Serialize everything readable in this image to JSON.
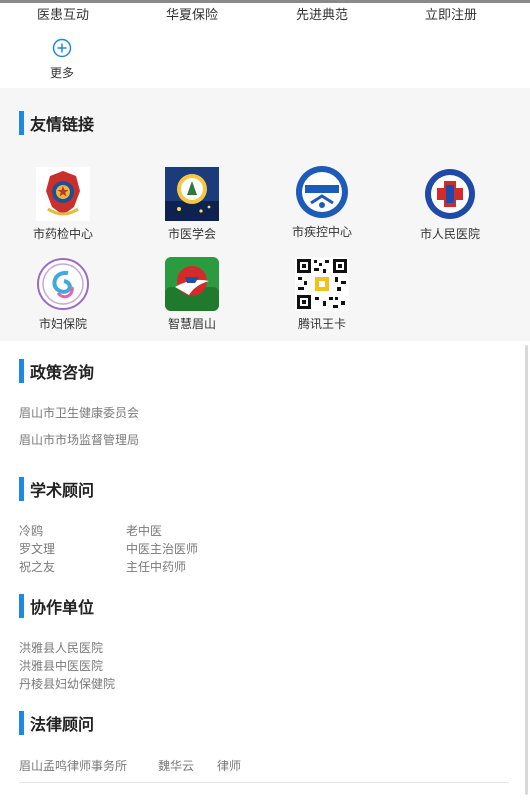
{
  "top_links": [
    "医患互动",
    "华夏保险",
    "先进典范",
    "立即注册"
  ],
  "more_label": "更多",
  "friend_links": {
    "title": "友情链接",
    "items": [
      {
        "label": "市药检中心",
        "icon": "police-emblem-logo"
      },
      {
        "label": "市医学会",
        "icon": "medical-association-logo"
      },
      {
        "label": "市疾控中心",
        "icon": "cdc-logo"
      },
      {
        "label": "市人民医院",
        "icon": "hospital-logo"
      },
      {
        "label": "市妇保院",
        "icon": "maternal-health-logo"
      },
      {
        "label": "智慧眉山",
        "icon": "smart-meishan-app-icon"
      },
      {
        "label": "腾讯王卡",
        "icon": "qr-code"
      }
    ]
  },
  "policy": {
    "title": "政策咨询",
    "items": [
      "眉山市卫生健康委员会",
      "眉山市市场监督管理局"
    ]
  },
  "academic": {
    "title": "学术顾问",
    "rows": [
      {
        "name": "冷鸥",
        "role": "老中医"
      },
      {
        "name": "罗文理",
        "role": "中医主治医师"
      },
      {
        "name": "祝之友",
        "role": "主任中药师"
      }
    ]
  },
  "partners": {
    "title": "协作单位",
    "items": [
      "洪雅县人民医院",
      "洪雅县中医医院",
      "丹棱县妇幼保健院"
    ]
  },
  "legal": {
    "title": "法律顾问",
    "firm": "眉山孟鸣律师事务所",
    "name": "魏华云",
    "role": "律师"
  },
  "colors": {
    "accent": "#1e88e5",
    "muted_text": "#7a7a7a",
    "section_bg": "#f6f6f6"
  }
}
